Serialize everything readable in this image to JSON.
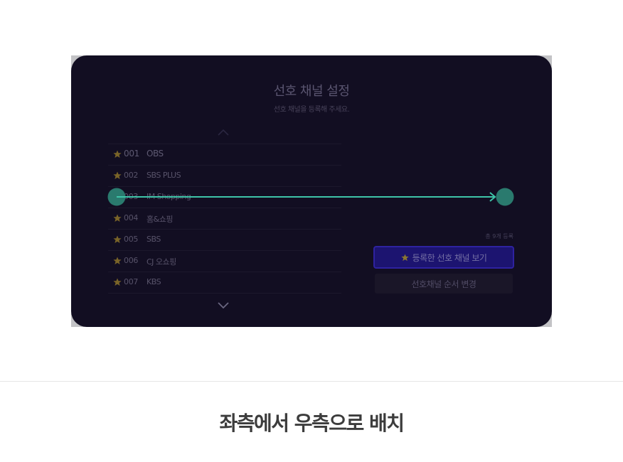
{
  "dialog": {
    "title": "선호 채널 설정",
    "subtitle": "선호 채널을 등록해 주세요."
  },
  "channels": [
    {
      "number": "001",
      "name": "OBS",
      "starred": true
    },
    {
      "number": "002",
      "name": "SBS PLUS",
      "starred": true
    },
    {
      "number": "003",
      "name": "IM Shopping",
      "starred": true
    },
    {
      "number": "004",
      "name": "홈&쇼핑",
      "starred": true
    },
    {
      "number": "005",
      "name": "SBS",
      "starred": true
    },
    {
      "number": "006",
      "name": "CJ 오쇼핑",
      "starred": true
    },
    {
      "number": "007",
      "name": "KBS",
      "starred": true
    }
  ],
  "summary": {
    "count_text": "총 9개 등록"
  },
  "buttons": {
    "view_favorites": "등록한 선호 채널 보기",
    "reorder": "선호채널 순서 변경"
  },
  "annotation": {
    "caption": "좌측에서 우측으로 배치",
    "gesture": "swipe-left-to-right"
  },
  "colors": {
    "panel_bg": "#120e22",
    "star": "#7a6428",
    "primary_button": "#1c1470",
    "gesture_accent": "#2a7a6e",
    "gesture_line": "#3ec4a8"
  },
  "icons": {
    "scroll_up": "chevron-up-icon",
    "scroll_down": "chevron-down-icon",
    "favorite": "star-icon"
  }
}
